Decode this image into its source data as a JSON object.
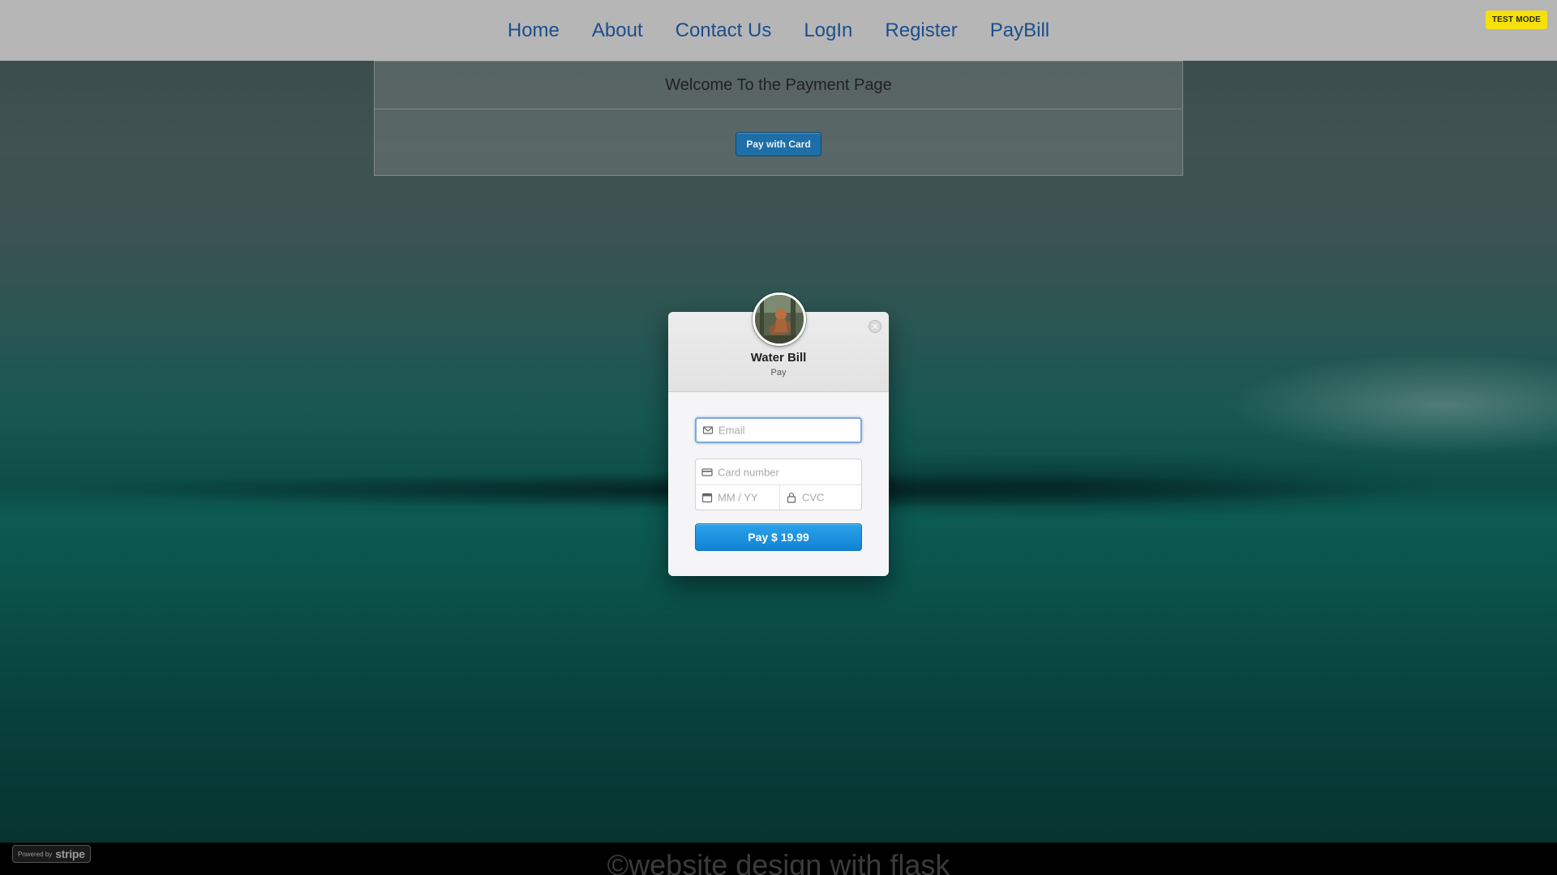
{
  "nav": {
    "items": [
      {
        "label": "Home"
      },
      {
        "label": "About"
      },
      {
        "label": "Contact Us"
      },
      {
        "label": "LogIn"
      },
      {
        "label": "Register"
      },
      {
        "label": "PayBill"
      }
    ]
  },
  "test_mode_label": "TEST MODE",
  "panel": {
    "title": "Welcome To the Payment Page",
    "pay_card_label": "Pay with Card"
  },
  "checkout": {
    "merchant_name": "Water Bill",
    "description": "Pay",
    "close_symbol": "✕",
    "email_placeholder": "Email",
    "card_number_placeholder": "Card number",
    "expiry_placeholder": "MM / YY",
    "cvc_placeholder": "CVC",
    "pay_button_label": "Pay $ 19.99",
    "accent_color": "#1183d4"
  },
  "footer": {
    "text": "©website design with flask"
  },
  "powered_badge": {
    "prefix": "Powered by",
    "brand": "stripe"
  },
  "icons": [
    "mail-icon",
    "credit-card-icon",
    "calendar-icon",
    "lock-icon",
    "close-icon",
    "merchant-avatar"
  ]
}
